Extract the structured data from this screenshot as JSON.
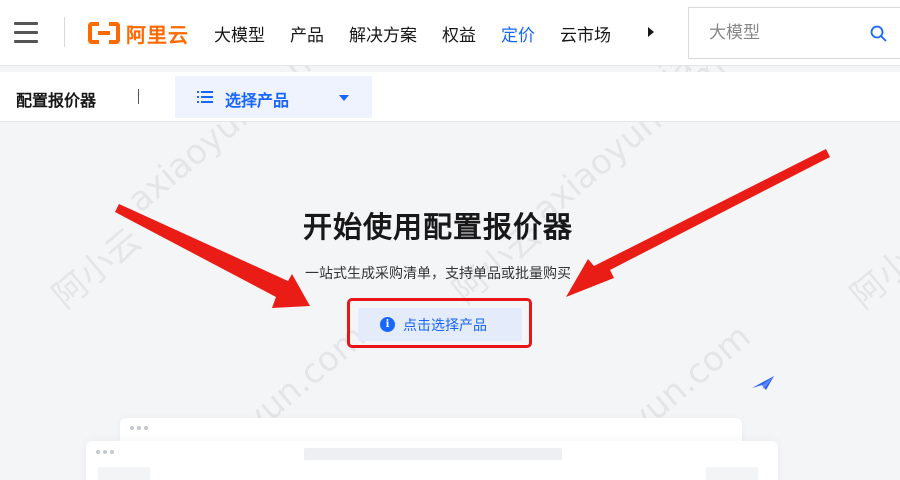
{
  "header": {
    "brand": "阿里云",
    "nav": [
      {
        "label": "大模型",
        "active": false
      },
      {
        "label": "产品",
        "active": false
      },
      {
        "label": "解决方案",
        "active": false
      },
      {
        "label": "权益",
        "active": false
      },
      {
        "label": "定价",
        "active": true
      },
      {
        "label": "云市场",
        "active": false
      }
    ],
    "search": {
      "placeholder": "大模型"
    }
  },
  "subheader": {
    "title": "配置报价器",
    "product_select_label": "选择产品"
  },
  "main": {
    "title": "开始使用配置报价器",
    "subtitle": "一站式生成采购清单，支持单品或批量购买",
    "cta_label": "点击选择产品",
    "cta_icon": "i"
  },
  "watermarks": [
    "axiaoyun.com",
    "阿小云"
  ],
  "colors": {
    "brand_orange": "#ff6a00",
    "accent_blue": "#1966ff",
    "annotation_red": "#e8151b",
    "page_bg": "#f4f5f7"
  },
  "icons": [
    "menu-icon",
    "search-icon",
    "list-icon",
    "chevron-down-icon",
    "info-icon",
    "paper-plane-icon",
    "more-arrow-icon"
  ]
}
